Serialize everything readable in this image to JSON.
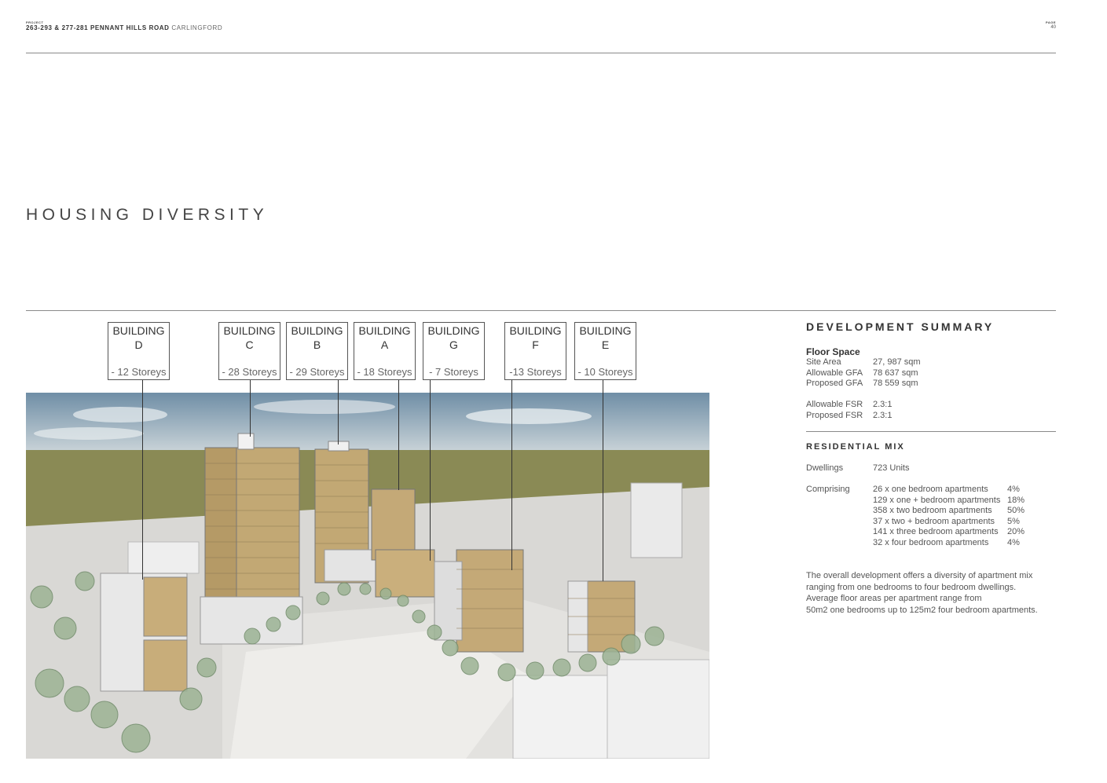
{
  "header": {
    "project_label": "PROJECT",
    "address": "263-293 & 277-281 PENNANT HILLS ROAD",
    "locality": "CARLINGFORD",
    "page_label": "PAGE",
    "page_number": "40"
  },
  "section_title": "HOUSING DIVERSITY",
  "buildings": [
    {
      "name": "BUILDING",
      "letter": "D",
      "storeys": "- 12 Storeys"
    },
    {
      "name": "BUILDING",
      "letter": "C",
      "storeys": "- 28 Storeys"
    },
    {
      "name": "BUILDING",
      "letter": "B",
      "storeys": "- 29 Storeys"
    },
    {
      "name": "BUILDING",
      "letter": "A",
      "storeys": "- 18 Storeys"
    },
    {
      "name": "BUILDING",
      "letter": "G",
      "storeys": "- 7 Storeys"
    },
    {
      "name": "BUILDING",
      "letter": "F",
      "storeys": "-13 Storeys"
    },
    {
      "name": "BUILDING",
      "letter": "E",
      "storeys": "- 10 Storeys"
    }
  ],
  "summary": {
    "title": "DEVELOPMENT SUMMARY",
    "floor_space": {
      "heading": "Floor Space",
      "site_area_label": "Site Area",
      "site_area_value": "27, 987  sqm",
      "allowable_gfa_label": "Allowable GFA",
      "allowable_gfa_value": "78 637 sqm",
      "proposed_gfa_label": "Proposed GFA",
      "proposed_gfa_value": "78 559 sqm",
      "allowable_fsr_label": "Allowable FSR",
      "allowable_fsr_value": "2.3:1",
      "proposed_fsr_label": "Proposed FSR",
      "proposed_fsr_value": "2.3:1"
    },
    "residential_mix": {
      "heading": "RESIDENTIAL MIX",
      "dwellings_label": "Dwellings",
      "dwellings_value": "723 Units",
      "comprising_label": "Comprising",
      "items": [
        {
          "text": "26 x one bedroom apartments",
          "pct": "4%"
        },
        {
          "text": "129 x one + bedroom apartments",
          "pct": "18%"
        },
        {
          "text": "358 x two bedroom apartments",
          "pct": "50%"
        },
        {
          "text": "37 x two + bedroom apartments",
          "pct": "5%"
        },
        {
          "text": "141 x three bedroom apartments",
          "pct": "20%"
        },
        {
          "text": "32 x four bedroom apartments",
          "pct": "4%"
        }
      ]
    },
    "description": [
      "The overall development offers a diversity of apartment mix",
      "ranging from one bedrooms to four bedroom dwellings.",
      "Average floor areas per apartment range from",
      "50m2 one bedrooms up to 125m2 four bedroom apartments."
    ]
  }
}
